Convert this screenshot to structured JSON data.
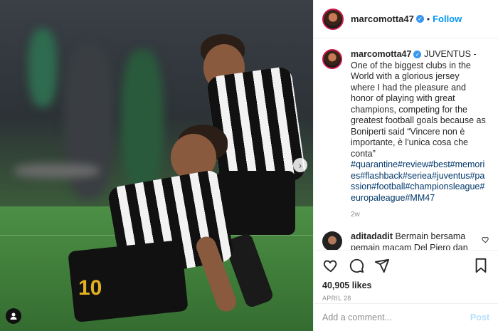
{
  "post": {
    "image_alt": "Two Juventus players celebrating on the pitch",
    "tagged_user_icon": "person-icon",
    "next_arrow": "›"
  },
  "header": {
    "username": "marcomotta47",
    "separator": "•",
    "follow_label": "Follow"
  },
  "caption": {
    "username": "marcomotta47",
    "text": "JUVENTUS - One of the biggest clubs in the World with a glorious jersey where I had the pleasure and honor of playing with great champions, competing for the greatest football goals because as Boniperti said “Vincere non è importante, è l'unica cosa che conta”",
    "hashtags": "#quarantine#review#best#memories#flashback#seriea#juventus#passion#football#championsleague#europaleague#MM47",
    "age": "2w"
  },
  "comments": [
    {
      "username": "aditadadit",
      "text": "Bermain bersama pemain macam Del Piero dan Juve hanya batu loncatan demi bisa bermain di liga baku hantam terbaik di dunia"
    }
  ],
  "actions": {
    "like_icon": "heart-icon",
    "comment_icon": "comment-icon",
    "share_icon": "share-icon",
    "save_icon": "bookmark-icon"
  },
  "likes": "40,905 likes",
  "date": "APRIL 28",
  "add_comment": {
    "placeholder": "Add a comment...",
    "post_label": "Post"
  },
  "colors": {
    "accent": "#0095f6",
    "hashtag": "#00376b",
    "muted": "#8e8e8e",
    "post_disabled": "#b2dffc"
  }
}
